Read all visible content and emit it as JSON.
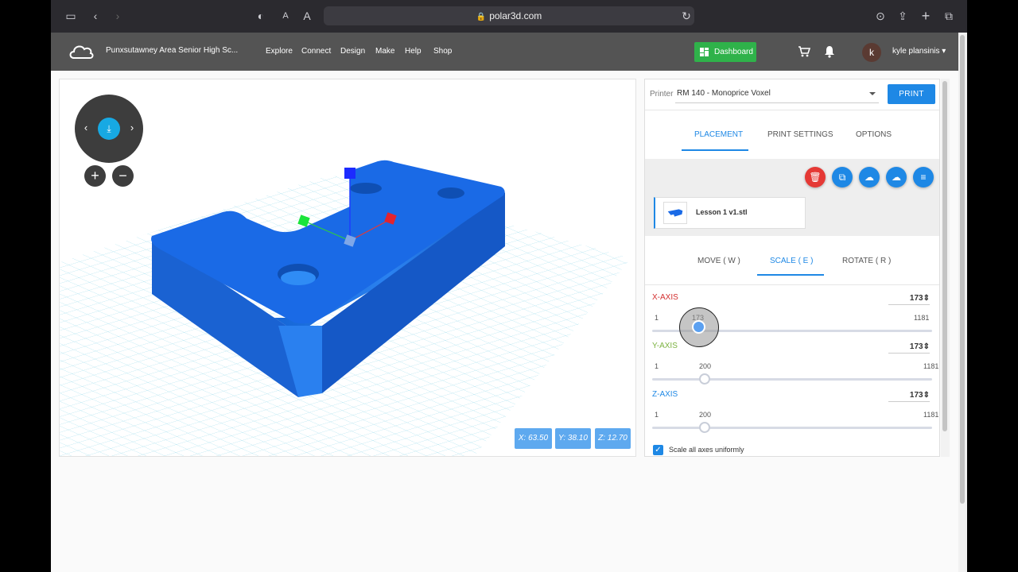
{
  "browser": {
    "url": "polar3d.com"
  },
  "header": {
    "school": "Punxsutawney Area Senior High Sc...",
    "nav": [
      "Explore",
      "Connect",
      "Design",
      "Make",
      "Help",
      "Shop"
    ],
    "dashboard_label": "Dashboard",
    "avatar_letter": "k",
    "username": "kyle plansinis",
    "username_caret": "▾"
  },
  "viewport": {
    "coords": {
      "x": "X: 63.50",
      "y": "Y: 38.10",
      "z": "Z: 12.70"
    },
    "zoom_in": "+",
    "zoom_out": "−"
  },
  "panel": {
    "printer_label": "Printer",
    "printer_value": "RM 140 - Monoprice Voxel",
    "print_label": "PRINT",
    "tabs": [
      "PLACEMENT",
      "PRINT SETTINGS",
      "OPTIONS"
    ],
    "active_tab": "PLACEMENT",
    "file_name": "Lesson 1 v1.stl",
    "subtabs": [
      "MOVE ( W )",
      "SCALE ( E )",
      "ROTATE ( R )"
    ],
    "active_subtab": "SCALE ( E )",
    "axes": [
      {
        "label": "X-AXIS",
        "value": "173",
        "min": "1",
        "current": "173",
        "max": "1181",
        "fraction": 0.146,
        "color": "#d32f2f"
      },
      {
        "label": "Y-AXIS",
        "value": "173",
        "min": "1",
        "current": "200",
        "max": "1181",
        "fraction": 0.169,
        "color": "#7cb342"
      },
      {
        "label": "Z-AXIS",
        "value": "173",
        "min": "1",
        "current": "200",
        "max": "1181",
        "fraction": 0.169,
        "color": "#1e88e5"
      }
    ],
    "uniform_label": "Scale all axes uniformly",
    "uniform_checked": true
  },
  "colors": {
    "accent": "#1e88e5",
    "model": "#1b6be0",
    "grid": "#7fd3e6",
    "delete": "#e53935",
    "dashboard": "#2fb24a"
  }
}
